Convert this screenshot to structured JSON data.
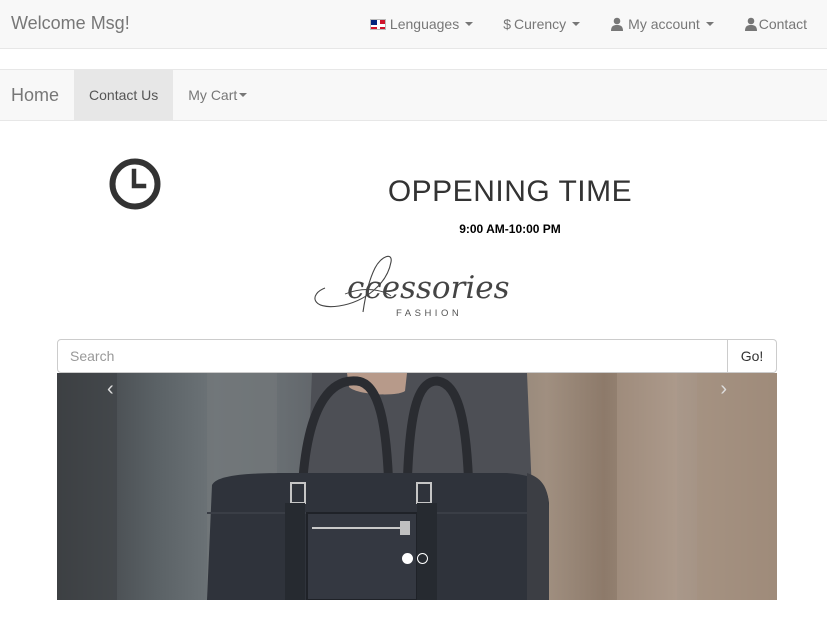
{
  "topbar": {
    "brand": "Welcome Msg!",
    "languages_label": "Lenguages",
    "currency_label": "Curency",
    "currency_symbol": "$",
    "account_label": "My account",
    "contact_label": "Contact"
  },
  "navbar": {
    "home_label": "Home",
    "contact_us_label": "Contact Us",
    "cart_label": "My Cart"
  },
  "opening": {
    "title": "OPPENING TIME",
    "hours": "9:00 AM-10:00 PM",
    "icon": "clock-icon"
  },
  "logo": {
    "script_text": "Accessories",
    "sub_text": "FASHION"
  },
  "search": {
    "placeholder": "Search",
    "value": "",
    "button_label": "Go!"
  },
  "carousel": {
    "prev_glyph": "‹",
    "next_glyph": "›",
    "slide_count": 2,
    "active_slide": 1
  },
  "colors": {
    "navbar_bg": "#f8f8f8",
    "active_nav_bg": "#e7e7e7",
    "text_muted": "#777777"
  }
}
